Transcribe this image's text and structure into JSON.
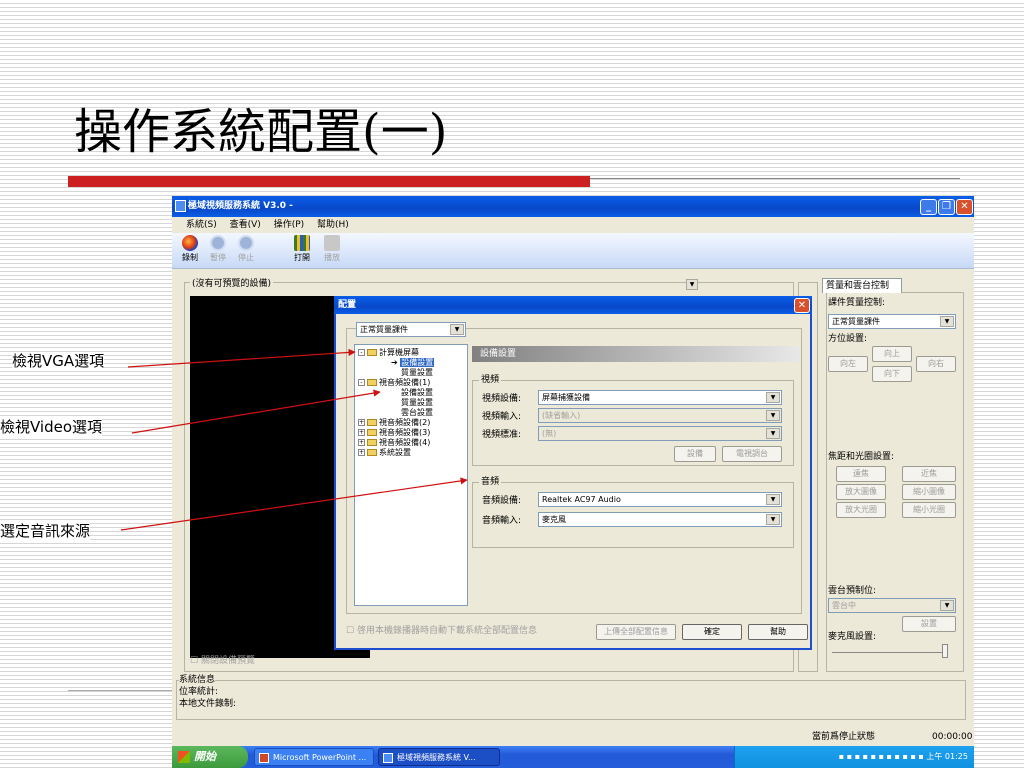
{
  "slide": {
    "title": "操作系統配置(一)"
  },
  "callouts": {
    "vga": "檢視VGA選項",
    "video": "檢視Video選項",
    "audio": "選定音訊來源"
  },
  "app": {
    "title": "極域視頻服務系統 V3.0 -",
    "menu": [
      "系統(S)",
      "查看(V)",
      "操作(P)",
      "幫助(H)"
    ],
    "toolbar": [
      {
        "label": "錄制",
        "icon": "record-icon",
        "enabled": true
      },
      {
        "label": "暫停",
        "icon": "pause-icon",
        "enabled": false
      },
      {
        "label": "停止",
        "icon": "stop-icon",
        "enabled": false
      },
      {
        "label": "打開",
        "icon": "open-icon",
        "enabled": true
      },
      {
        "label": "播放",
        "icon": "play-icon",
        "enabled": false
      }
    ],
    "preview_device": "(沒有可預覽的設備)",
    "close_preview": "關閉設備預覽",
    "system_info": {
      "label": "系統信息",
      "bitrate": "位率統計:",
      "local_record": "本地文件錄制:"
    },
    "status": {
      "state": "當前爲停止狀態",
      "time": "00:00:00"
    }
  },
  "control_panel": {
    "tab": "質量和雲台控制",
    "quality_label": "課件質量控制:",
    "quality_value": "正常質量課件",
    "direction_label": "方位設置:",
    "dir_up": "向上",
    "dir_left": "向左",
    "dir_right": "向右",
    "dir_down": "向下",
    "focus_label": "焦距和光圈設置:",
    "far": "遠焦",
    "near": "近焦",
    "zoom_in": "放大圖像",
    "zoom_out": "縮小圖像",
    "iris_open": "放大光圈",
    "iris_close": "縮小光圈",
    "preset_label": "雲台預制位:",
    "preset_value": "雲台中",
    "set": "設置",
    "mic_label": "麥克風設置:"
  },
  "dialog": {
    "title": "配置",
    "profile": "正常質量課件",
    "tree": [
      {
        "label": "計算機屏幕",
        "level": 0,
        "expander": "-",
        "folder": true
      },
      {
        "label": "設備設置",
        "level": 1,
        "selected": true
      },
      {
        "label": "質量設置",
        "level": 1
      },
      {
        "label": "視音頻設備(1)",
        "level": 0,
        "expander": "-",
        "folder": true
      },
      {
        "label": "設備設置",
        "level": 1
      },
      {
        "label": "質量設置",
        "level": 1
      },
      {
        "label": "雲台設置",
        "level": 1
      },
      {
        "label": "視音頻設備(2)",
        "level": 0,
        "expander": "+",
        "folder": true
      },
      {
        "label": "視音頻設備(3)",
        "level": 0,
        "expander": "+",
        "folder": true
      },
      {
        "label": "視音頻設備(4)",
        "level": 0,
        "expander": "+",
        "folder": true
      },
      {
        "label": "系統設置",
        "level": 0,
        "expander": "+",
        "folder": true
      }
    ],
    "section_header": "設備設置",
    "video": {
      "legend": "視頻",
      "device_label": "視頻設備:",
      "device_value": "屏幕捕獲設備",
      "input_label": "視頻輸入:",
      "input_value": "(缺省輸入)",
      "standard_label": "視頻標准:",
      "standard_value": "(無)",
      "settings_btn": "設備",
      "adjust_btn": "電視調台"
    },
    "audio": {
      "legend": "音頻",
      "device_label": "音頻設備:",
      "device_value": "Realtek AC97 Audio",
      "input_label": "音頻輸入:",
      "input_value": "麥克風"
    },
    "auto_download": "啓用本機錄播器時自動下載系統全部配置信息",
    "upload_btn": "上傳全部配置信息",
    "ok_btn": "確定",
    "help_btn": "幫助"
  },
  "taskbar": {
    "start": "開始",
    "tasks": [
      "Microsoft PowerPoint ...",
      "極域視頻服務系統 V..."
    ],
    "clock": "上午 01:25"
  },
  "colors": {
    "accent_red": "#cc1f1f",
    "xp_blue": "#0a5ee8",
    "selection": "#316ac5"
  }
}
